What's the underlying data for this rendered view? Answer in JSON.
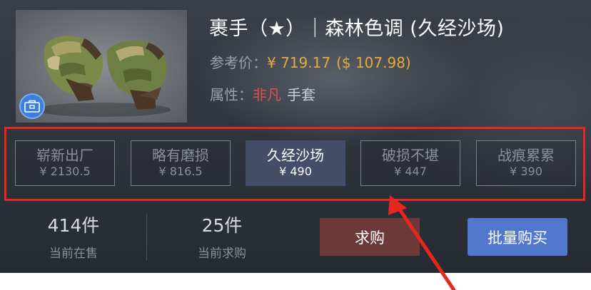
{
  "item": {
    "title": "裹手（★）｜森林色调 (久经沙场)",
    "price_label": "参考价：",
    "price_cny": "¥ 719.17",
    "price_usd": "($ 107.98)",
    "attr_label": "属性：",
    "attr_rarity": "非凡",
    "attr_type": "手套",
    "image_icon": "gloves-image",
    "badge_icon": "case-icon"
  },
  "wear_options": [
    {
      "name": "崭新出厂",
      "price": "¥ 2130.5",
      "active": false
    },
    {
      "name": "略有磨损",
      "price": "¥ 816.5",
      "active": false
    },
    {
      "name": "久经沙场",
      "price": "¥ 490",
      "active": true
    },
    {
      "name": "破损不堪",
      "price": "¥ 447",
      "active": false
    },
    {
      "name": "战痕累累",
      "price": "¥ 390",
      "active": false
    }
  ],
  "stats": {
    "on_sale_count": "414件",
    "on_sale_label": "当前在售",
    "wanted_count": "25件",
    "wanted_label": "当前求购"
  },
  "buttons": {
    "want_label": "求购",
    "bulk_label": "批量购买"
  },
  "colors": {
    "accent_price": "#e7a93a",
    "rarity": "#e05050",
    "active_wear": "#454e69",
    "want_button": "#6c3838",
    "bulk_button": "#5178cd",
    "annotation": "#e6261f"
  }
}
